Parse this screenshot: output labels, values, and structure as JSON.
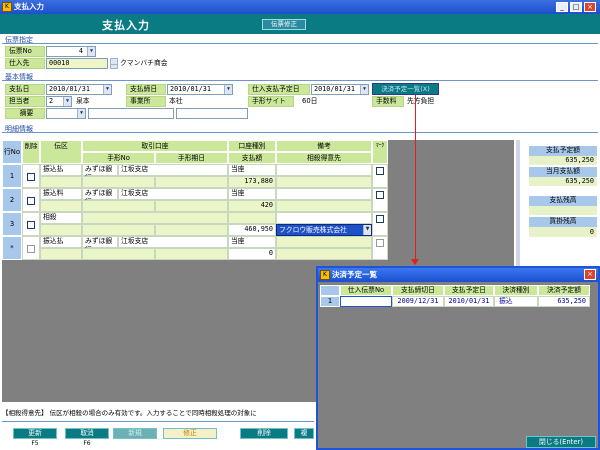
{
  "window": {
    "title": "支払入力",
    "minimize": "_",
    "maximize": "□",
    "close": "×"
  },
  "banner": {
    "title": "支払入力",
    "badge": "伝票修正"
  },
  "denpyo": {
    "section": "伝票指定",
    "no_label": "伝票No",
    "no_value": "4",
    "shiire_label": "仕入先",
    "shiire_code": "00010",
    "shiire_name": "クマンバチ商会"
  },
  "basic": {
    "section": "基本情報",
    "shiharai_label": "支払日",
    "shiharai_value": "2010/01/31",
    "shimekiri_label": "支払締日",
    "shimekiri_value": "2010/01/31",
    "yotei_label": "仕入支払予定日",
    "yotei_value": "2010/01/31",
    "kessai_button": "決済予定一覧(X)",
    "tanto_label": "担当者",
    "tanto_code": "2",
    "tanto_name": "泉本",
    "jigyosho_label": "事業所",
    "jigyosho_value": "本社",
    "tegata_label": "手形サイト",
    "tegata_value": "60日",
    "tesuryo_label": "手数料",
    "tesuryo_value": "先方負担",
    "tekiyo_label": "摘要"
  },
  "detail": {
    "section": "明細情報",
    "headers": {
      "gyo": "行No",
      "sakujo": "削除",
      "denku": "伝区",
      "torihiki": "取引口座",
      "tegata_no": "手形No",
      "tegata_kijitsu": "手形期日",
      "koza_shubetsu": "口座種別",
      "shiharai_gaku": "支払額",
      "biko": "備考",
      "sosai": "相殺得意先",
      "mark": "ﾏｰｸ"
    },
    "rows": [
      {
        "no": "1",
        "denku": "振込払",
        "bank": "みずほ銀行",
        "branch": "江坂支店",
        "type": "当座",
        "amount": "173,880",
        "biko": ""
      },
      {
        "no": "2",
        "denku": "振込料",
        "bank": "みずほ銀行",
        "branch": "江坂支店",
        "type": "当座",
        "amount": "420",
        "biko": ""
      },
      {
        "no": "3",
        "denku": "相殺",
        "bank": "",
        "branch": "",
        "type": "",
        "amount": "460,950",
        "biko": "フクロウ販売株式会社"
      },
      {
        "no": "*",
        "denku": "振込払",
        "bank": "みずほ銀行",
        "branch": "江坂支店",
        "type": "当座",
        "amount": "0",
        "biko": ""
      }
    ]
  },
  "side": {
    "yotei_label": "支払予定額",
    "yotei_value": "635,250",
    "tougetsu_label": "当月支払額",
    "tougetsu_value": "635,250",
    "zandaka_label": "支払残高",
    "zandaka_value": "",
    "kaikake_label": "買掛残高",
    "kaikake_value": "0"
  },
  "hint": "【相殺得意先】 伝区が相殺の場合のみ有効です。入力することで同時相殺処理の対象に",
  "fkeys": [
    {
      "label": "更新",
      "key": "F5"
    },
    {
      "label": "取消",
      "key": "F6"
    },
    {
      "label": "新規",
      "key": ""
    },
    {
      "label": "修正",
      "key": ""
    },
    {
      "label": "削除",
      "key": ""
    },
    {
      "label": "複",
      "key": ""
    }
  ],
  "popup": {
    "title": "決済予定一覧",
    "headers": [
      "仕入伝票No",
      "支払締切日",
      "支払予定日",
      "決済種別",
      "決済予定額"
    ],
    "row": {
      "no": "1",
      "denpyo": "",
      "shimekiri": "2009/12/31",
      "yotei": "2010/01/31",
      "shubetsu": "振込",
      "gaku": "635,250"
    },
    "close_button": "閉じる(Enter)"
  },
  "colors": {
    "banner": "#0a7a83",
    "label_green": "#cbe89a",
    "titlebar": "#1d4fcc",
    "row_blue": "#a7c8ea"
  }
}
